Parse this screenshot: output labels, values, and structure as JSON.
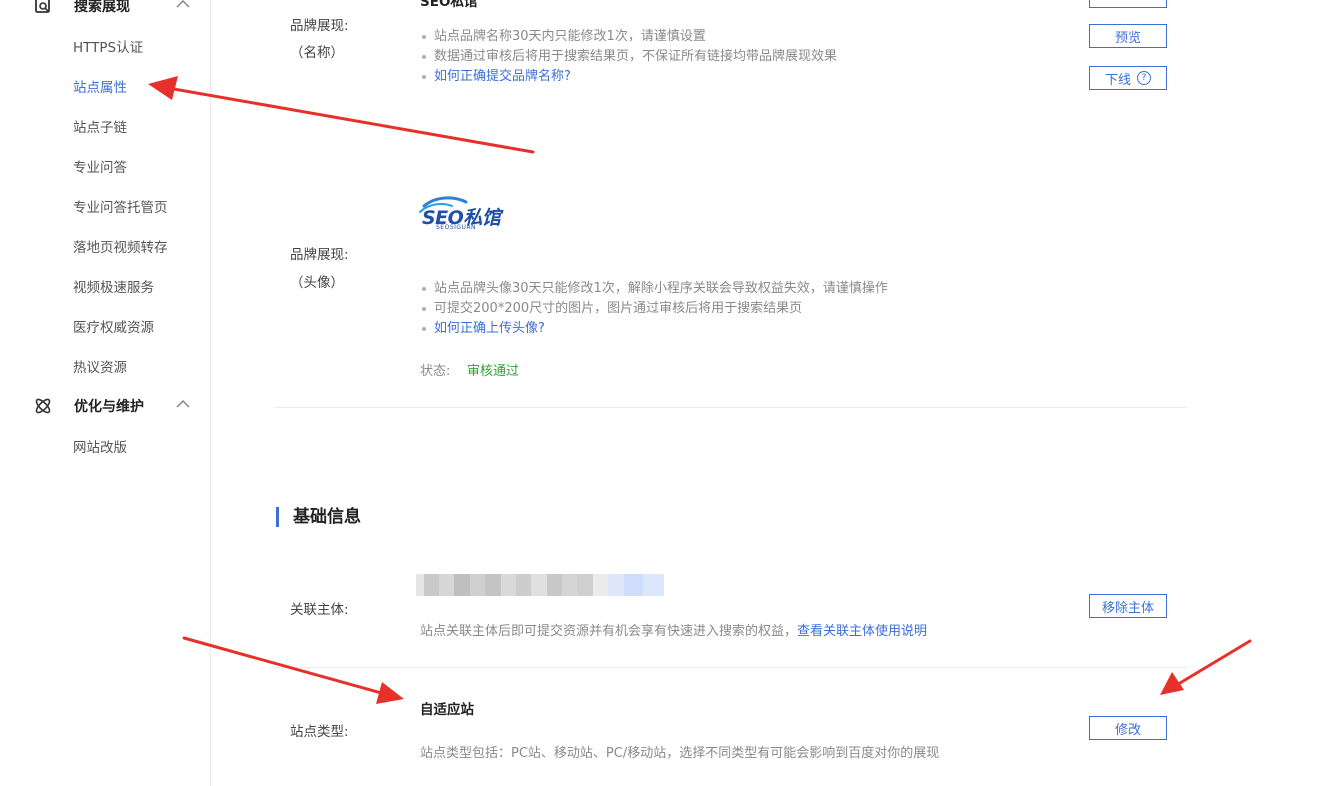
{
  "sidebar": {
    "group1": {
      "title": "搜索展现",
      "icon": "search-doc-icon"
    },
    "items": [
      {
        "label": "HTTPS认证"
      },
      {
        "label": "站点属性",
        "active": true
      },
      {
        "label": "站点子链"
      },
      {
        "label": "专业问答"
      },
      {
        "label": "专业问答托管页"
      },
      {
        "label": "落地页视频转存"
      },
      {
        "label": "视频极速服务"
      },
      {
        "label": "医疗权威资源"
      },
      {
        "label": "热议资源"
      }
    ],
    "group2": {
      "title": "优化与维护",
      "icon": "atom-icon"
    },
    "items2": [
      {
        "label": "网站改版"
      }
    ]
  },
  "brand_name": {
    "label": "品牌展现:",
    "sublabel": "（名称）",
    "value_partial": "SEO私馆",
    "tips": [
      "站点品牌名称30天内只能修改1次，请谨慎设置",
      "数据通过审核后将用于搜索结果页，不保证所有链接均带品牌展现效果",
      "如何正确提交品牌名称?"
    ],
    "buttons": {
      "preview": "预览",
      "offline": "下线"
    }
  },
  "brand_avatar": {
    "label": "品牌展现:",
    "sublabel": "（头像）",
    "logo_text": "SEO私馆",
    "logo_subtext": "SEOSIGUAN",
    "tips": [
      "站点品牌头像30天只能修改1次，解除小程序关联会导致权益失效，请谨慎操作",
      "可提交200*200尺寸的图片，图片通过审核后将用于搜索结果页",
      "如何正确上传头像?"
    ],
    "status_label": "状态:",
    "status_value": "审核通过"
  },
  "basic_info": {
    "title": "基础信息",
    "entity": {
      "label": "关联主体:",
      "desc": "站点关联主体后即可提交资源并有机会享有快速进入搜索的权益，",
      "desc_link": "查看关联主体使用说明",
      "button": "移除主体"
    },
    "site_type": {
      "label": "站点类型:",
      "value": "自适应站",
      "desc": "站点类型包括：PC站、移动站、PC/移动站，选择不同类型有可能会影响到百度对你的展现",
      "button": "修改"
    }
  },
  "colors": {
    "accent": "#3d6fd8",
    "success": "#2fa52f",
    "annotation": "#e8302a"
  }
}
